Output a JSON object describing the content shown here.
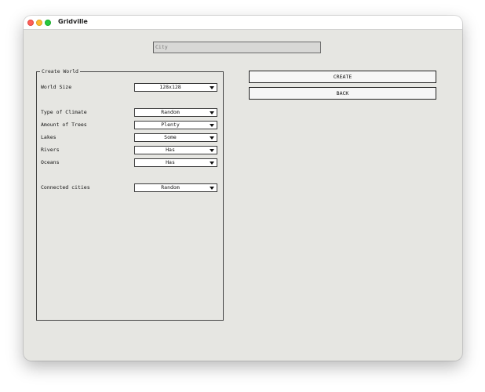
{
  "window": {
    "title": "Gridville"
  },
  "city": {
    "placeholder": "City",
    "value": ""
  },
  "create_world": {
    "legend": "Create World",
    "rows": [
      {
        "label": "World Size",
        "value": "128x128"
      },
      {
        "label": "Type of Climate",
        "value": "Random"
      },
      {
        "label": "Amount of Trees",
        "value": "Plenty"
      },
      {
        "label": "Lakes",
        "value": "Some"
      },
      {
        "label": "Rivers",
        "value": "Has"
      },
      {
        "label": "Oceans",
        "value": "Has"
      },
      {
        "label": "Connected cities",
        "value": "Random"
      }
    ]
  },
  "buttons": {
    "create": "CREATE",
    "back": "BACK"
  },
  "colors": {
    "window_bg": "#e6e6e2",
    "close": "#ff5f57",
    "minimize": "#febc2e",
    "maximize": "#28c840"
  }
}
